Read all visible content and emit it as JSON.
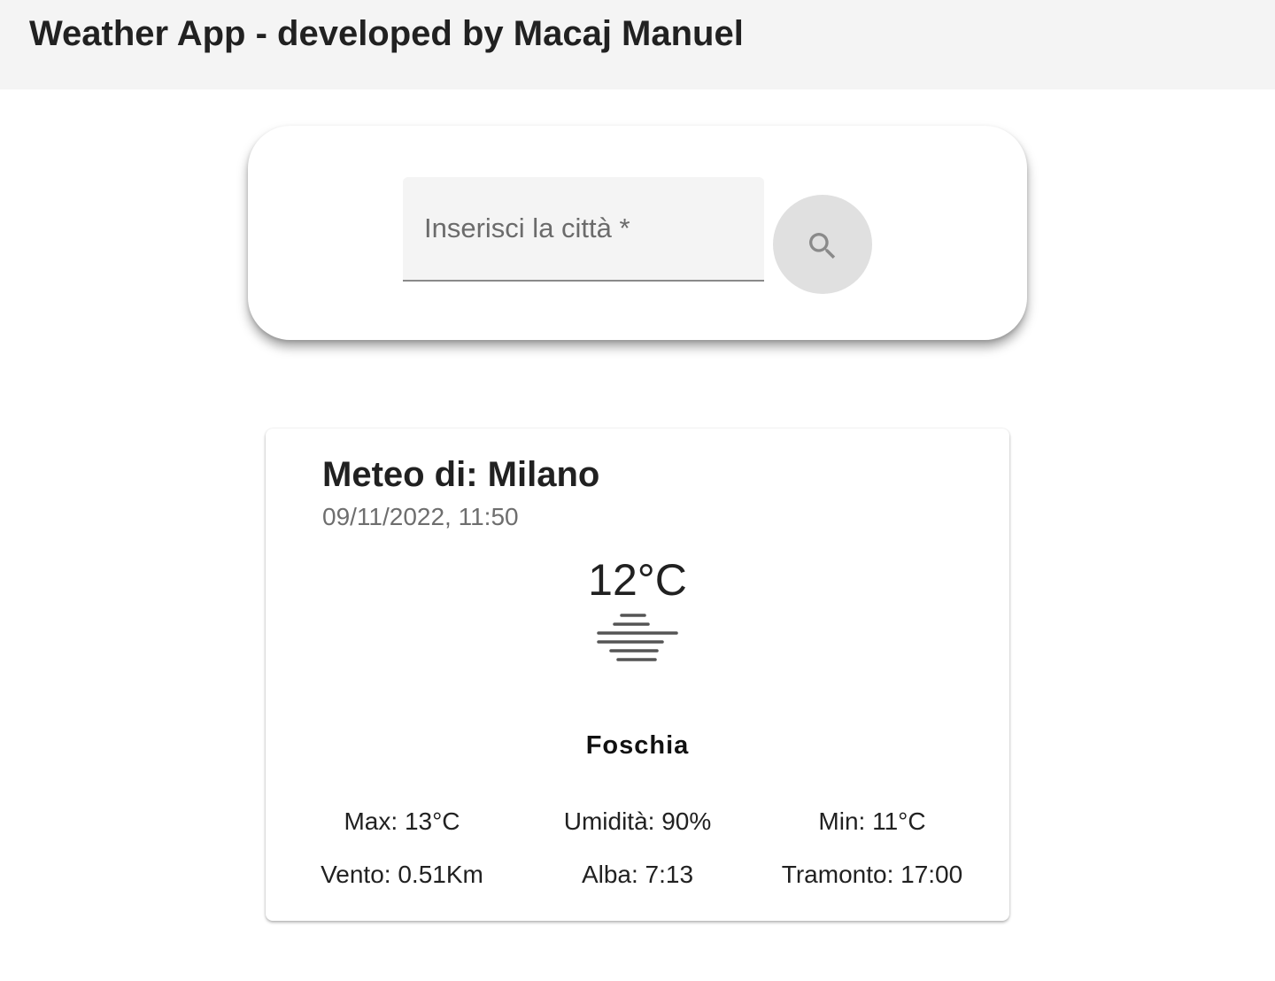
{
  "header": {
    "title": "Weather App - developed by Macaj Manuel"
  },
  "search": {
    "placeholder": "Inserisci la città *",
    "value": "",
    "button_icon": "search-icon"
  },
  "weather": {
    "city_title": "Meteo di: Milano",
    "datetime": "09/11/2022, 11:50",
    "temperature": "12°C",
    "condition_icon": "fog-icon",
    "condition": "Foschia",
    "stats": {
      "max": "Max: 13°C",
      "humidity": "Umidità: 90%",
      "min": "Min: 11°C",
      "wind": "Vento: 0.51Km",
      "sunrise": "Alba: 7:13",
      "sunset": "Tramonto: 17:00"
    }
  },
  "colors": {
    "app_bar": "#f4f4f4",
    "text": "#212121",
    "secondary_text": "#6e6e6e",
    "search_button": "#e0e0e0"
  }
}
